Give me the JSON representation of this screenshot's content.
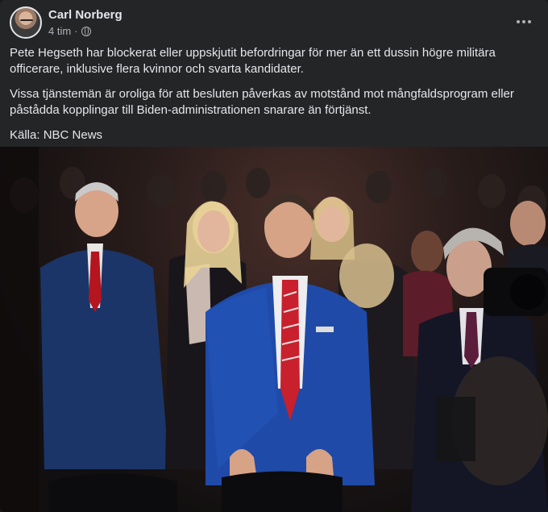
{
  "post": {
    "author": "Carl Norberg",
    "time": "4 tim",
    "separator": "·",
    "privacy_icon": "globe-icon",
    "more_icon": "more-options-icon",
    "paragraphs": [
      "Pete Hegseth har blockerat eller uppskjutit befordringar för mer än ett dussin högre militära officerare, inklusive flera kvinnor och svarta kandidater.",
      "Vissa tjänstemän är oroliga för att besluten påverkas av motstånd mot mångfaldsprogram eller påstådda kopplingar till Biden-administrationen snarare än förtjänst.",
      "Källa: NBC News"
    ]
  },
  "colors": {
    "card_background": "#242526",
    "text_primary": "#e4e6eb",
    "text_secondary": "#b0b3b8",
    "suit_blue": "#1f4aa8",
    "tie_red": "#c8202c"
  }
}
